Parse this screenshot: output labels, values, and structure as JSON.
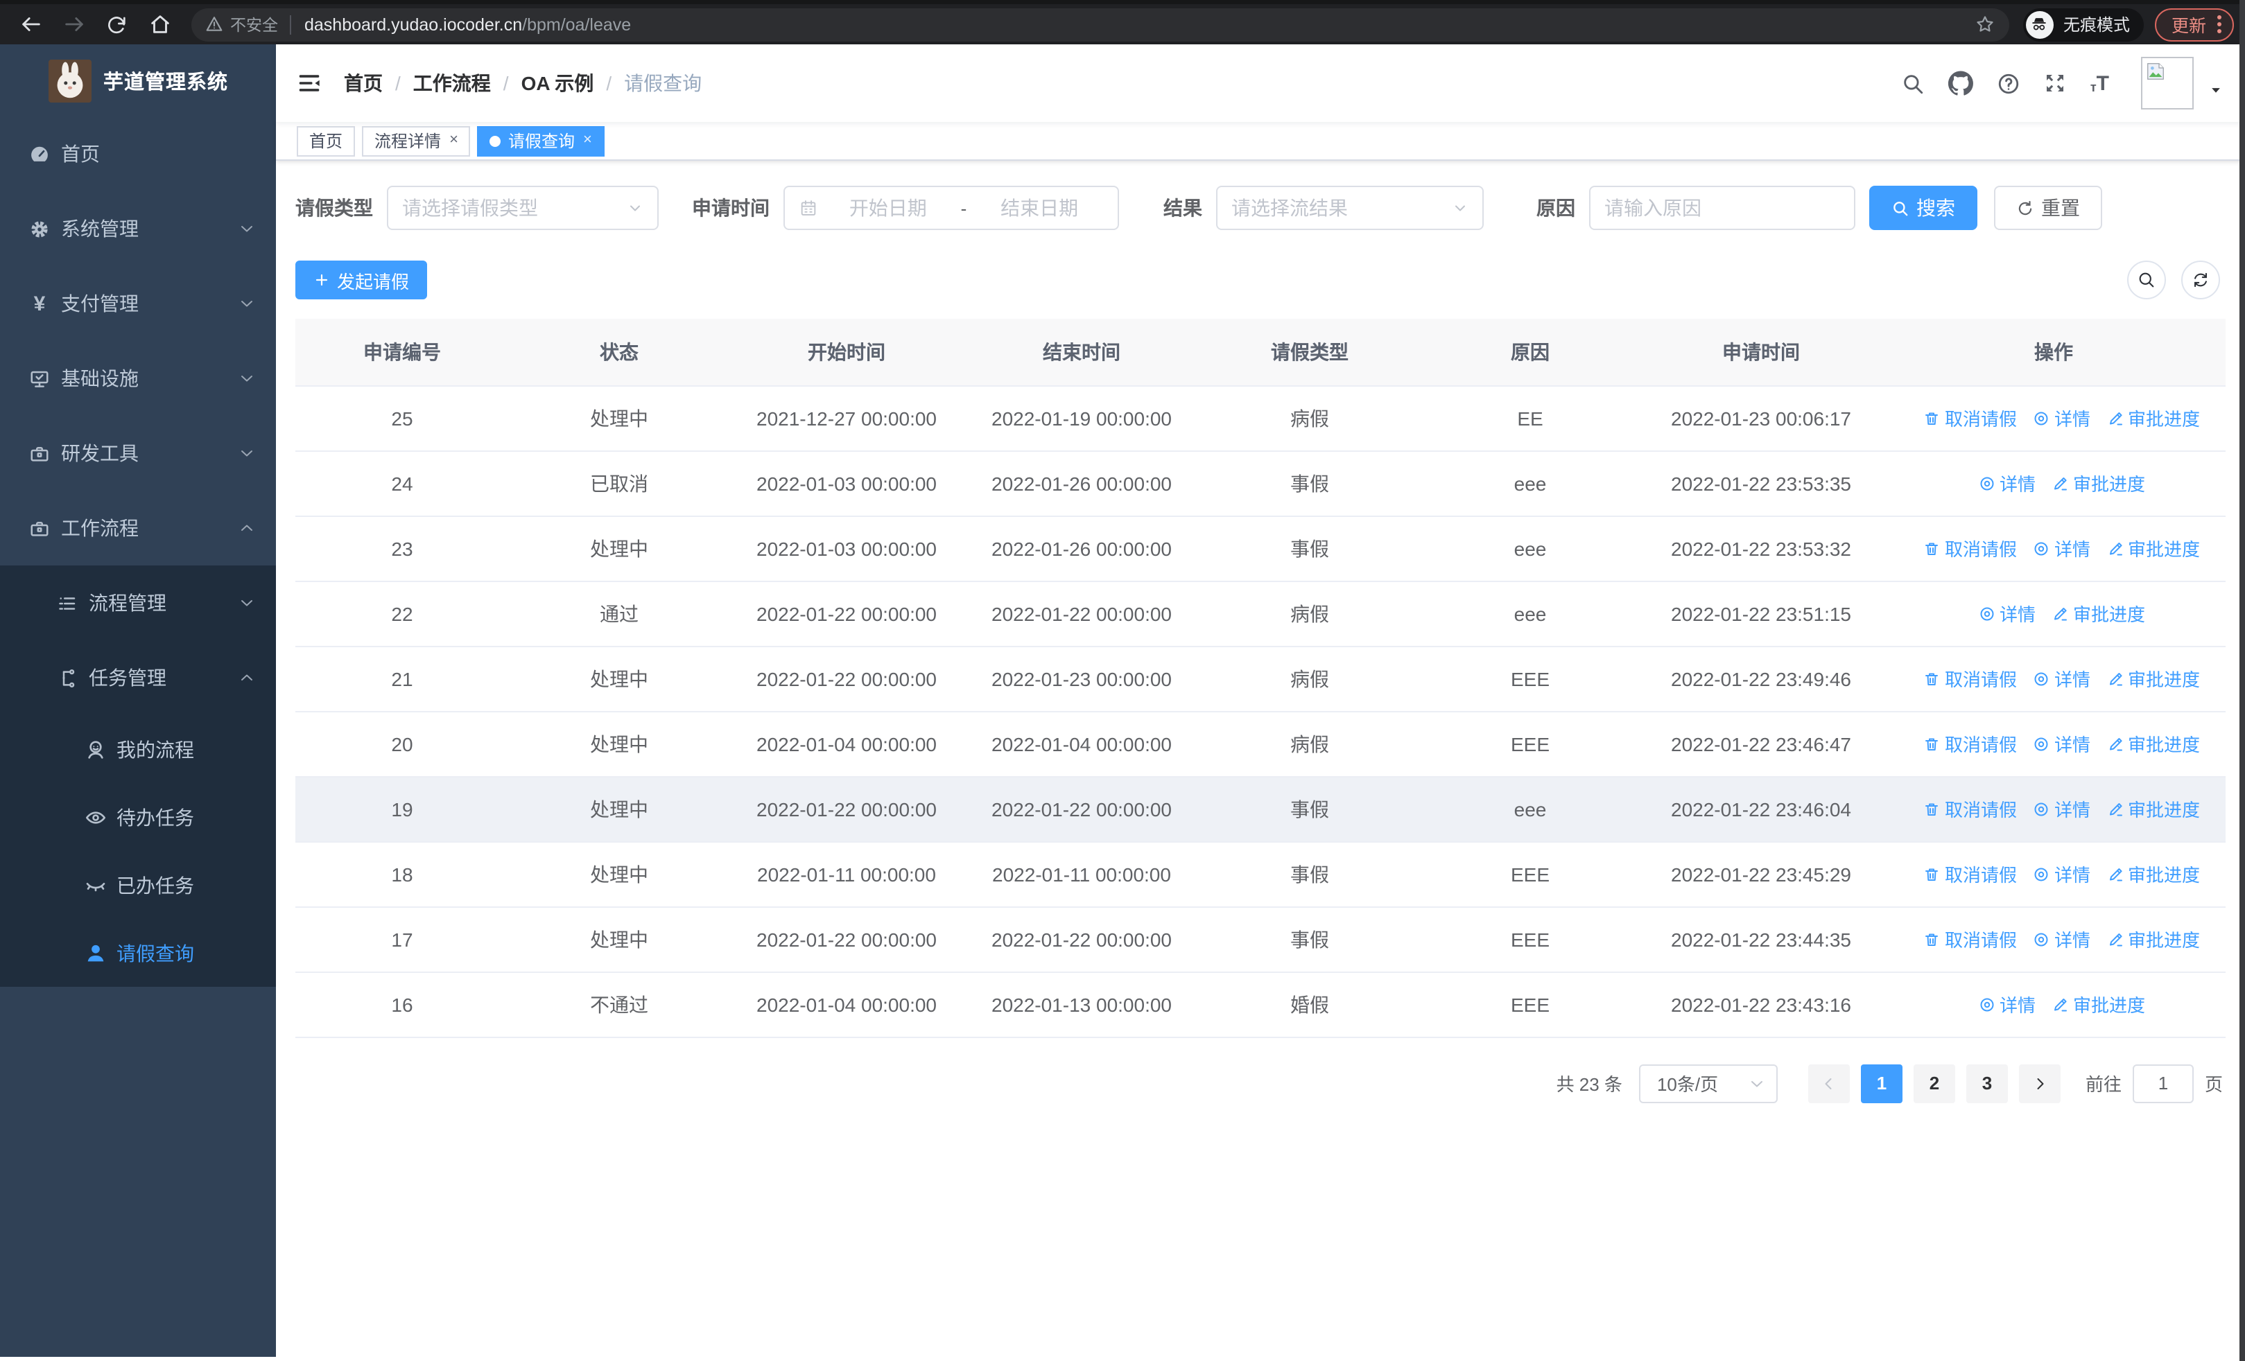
{
  "browser": {
    "security_label": "不安全",
    "url_host": "dashboard.yudao.iocoder.cn",
    "url_path": "/bpm/oa/leave",
    "incognito_label": "无痕模式",
    "update_label": "更新"
  },
  "sidebar": {
    "title": "芋道管理系统",
    "menu": [
      {
        "key": "home",
        "label": "首页",
        "icon": "dashboard",
        "level": 1
      },
      {
        "key": "system",
        "label": "系统管理",
        "icon": "gear",
        "level": 1,
        "arrow": "down"
      },
      {
        "key": "payment",
        "label": "支付管理",
        "icon": "yen",
        "level": 1,
        "arrow": "down"
      },
      {
        "key": "infrastructure",
        "label": "基础设施",
        "icon": "monitor",
        "level": 1,
        "arrow": "down"
      },
      {
        "key": "dev-tools",
        "label": "研发工具",
        "icon": "toolbox",
        "level": 1,
        "arrow": "down"
      },
      {
        "key": "workflow",
        "label": "工作流程",
        "icon": "briefcase",
        "level": 1,
        "arrow": "up"
      },
      {
        "key": "process-mgmt",
        "label": "流程管理",
        "icon": "list",
        "level": 2,
        "arrow": "down"
      },
      {
        "key": "task-mgmt",
        "label": "任务管理",
        "icon": "tree",
        "level": 2,
        "arrow": "up"
      },
      {
        "key": "my-process",
        "label": "我的流程",
        "icon": "user-face",
        "level": 3
      },
      {
        "key": "todo-tasks",
        "label": "待办任务",
        "icon": "eye-open",
        "level": 3
      },
      {
        "key": "done-tasks",
        "label": "已办任务",
        "icon": "eye-closed",
        "level": 3
      },
      {
        "key": "leave-query",
        "label": "请假查询",
        "icon": "user-solid",
        "level": 3,
        "active": true
      }
    ]
  },
  "navbar": {
    "breadcrumb": [
      "首页",
      "工作流程",
      "OA 示例",
      "请假查询"
    ]
  },
  "tags": [
    {
      "key": "home",
      "label": "首页"
    },
    {
      "key": "process-detail",
      "label": "流程详情",
      "closable": true
    },
    {
      "key": "leave-query",
      "label": "请假查询",
      "closable": true,
      "active": true
    }
  ],
  "filter": {
    "leave_type_label": "请假类型",
    "leave_type_placeholder": "请选择请假类型",
    "apply_time_label": "申请时间",
    "date_start_placeholder": "开始日期",
    "date_separator": "-",
    "date_end_placeholder": "结束日期",
    "result_label": "结果",
    "result_placeholder": "请选择流结果",
    "reason_label": "原因",
    "reason_placeholder": "请输入原因",
    "search_label": "搜索",
    "reset_label": "重置"
  },
  "toolbar": {
    "create_label": "发起请假"
  },
  "table": {
    "headers": [
      "申请编号",
      "状态",
      "开始时间",
      "结束时间",
      "请假类型",
      "原因",
      "申请时间",
      "操作"
    ],
    "action_labels": {
      "cancel": "取消请假",
      "detail": "详情",
      "progress": "审批进度"
    },
    "rows": [
      {
        "id": "25",
        "status": "处理中",
        "start": "2021-12-27 00:00:00",
        "end": "2022-01-19 00:00:00",
        "type": "病假",
        "reason": "EE",
        "applied": "2022-01-23 00:06:17",
        "cancel": true
      },
      {
        "id": "24",
        "status": "已取消",
        "start": "2022-01-03 00:00:00",
        "end": "2022-01-26 00:00:00",
        "type": "事假",
        "reason": "eee",
        "applied": "2022-01-22 23:53:35",
        "cancel": false
      },
      {
        "id": "23",
        "status": "处理中",
        "start": "2022-01-03 00:00:00",
        "end": "2022-01-26 00:00:00",
        "type": "事假",
        "reason": "eee",
        "applied": "2022-01-22 23:53:32",
        "cancel": true
      },
      {
        "id": "22",
        "status": "通过",
        "start": "2022-01-22 00:00:00",
        "end": "2022-01-22 00:00:00",
        "type": "病假",
        "reason": "eee",
        "applied": "2022-01-22 23:51:15",
        "cancel": false
      },
      {
        "id": "21",
        "status": "处理中",
        "start": "2022-01-22 00:00:00",
        "end": "2022-01-23 00:00:00",
        "type": "病假",
        "reason": "EEE",
        "applied": "2022-01-22 23:49:46",
        "cancel": true
      },
      {
        "id": "20",
        "status": "处理中",
        "start": "2022-01-04 00:00:00",
        "end": "2022-01-04 00:00:00",
        "type": "病假",
        "reason": "EEE",
        "applied": "2022-01-22 23:46:47",
        "cancel": true
      },
      {
        "id": "19",
        "status": "处理中",
        "start": "2022-01-22 00:00:00",
        "end": "2022-01-22 00:00:00",
        "type": "事假",
        "reason": "eee",
        "applied": "2022-01-22 23:46:04",
        "cancel": true,
        "highlight": true
      },
      {
        "id": "18",
        "status": "处理中",
        "start": "2022-01-11 00:00:00",
        "end": "2022-01-11 00:00:00",
        "type": "事假",
        "reason": "EEE",
        "applied": "2022-01-22 23:45:29",
        "cancel": true
      },
      {
        "id": "17",
        "status": "处理中",
        "start": "2022-01-22 00:00:00",
        "end": "2022-01-22 00:00:00",
        "type": "事假",
        "reason": "EEE",
        "applied": "2022-01-22 23:44:35",
        "cancel": true
      },
      {
        "id": "16",
        "status": "不通过",
        "start": "2022-01-04 00:00:00",
        "end": "2022-01-13 00:00:00",
        "type": "婚假",
        "reason": "EEE",
        "applied": "2022-01-22 23:43:16",
        "cancel": false
      }
    ]
  },
  "pagination": {
    "total": "共 23 条",
    "page_size": "10条/页",
    "pages": [
      "1",
      "2",
      "3"
    ],
    "current": "1",
    "goto_label": "前往",
    "goto_value": "1",
    "unit_label": "页"
  },
  "colors": {
    "accent": "#409eff",
    "sidebar_bg": "#304156",
    "submenu_bg": "#1f2d3d"
  }
}
